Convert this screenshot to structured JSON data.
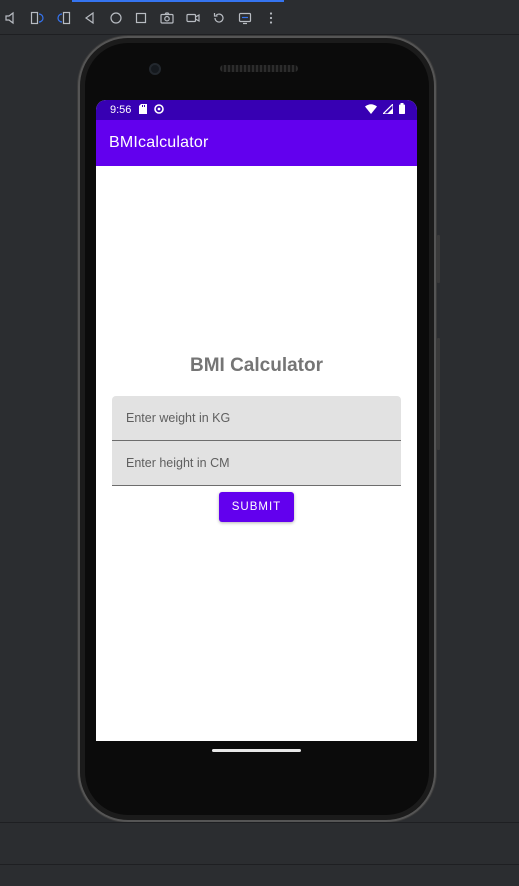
{
  "status_bar": {
    "time": "9:56",
    "icons": [
      "sd-card-icon",
      "data-saver-icon",
      "wifi-icon",
      "signal-icon",
      "battery-icon"
    ]
  },
  "app_bar": {
    "title": "BMIcalculator"
  },
  "main": {
    "heading": "BMI Calculator",
    "weight_field": {
      "placeholder": "Enter weight in KG",
      "value": ""
    },
    "height_field": {
      "placeholder": "Enter height in CM",
      "value": ""
    },
    "submit_label": "SUBMIT"
  },
  "toolbar": {
    "icons": [
      "volume-icon",
      "rotate-left-icon",
      "rotate-right-icon",
      "back-icon",
      "home-icon",
      "overview-icon",
      "screenshot-icon",
      "screen-record-icon",
      "snapshot-icon",
      "folded-icon",
      "more-icon"
    ]
  },
  "colors": {
    "primary": "#6200ee",
    "primary_dark": "#3700b3",
    "heading_text": "#757575",
    "field_background": "#e2e2e2",
    "ide_background": "#2b2d30"
  }
}
